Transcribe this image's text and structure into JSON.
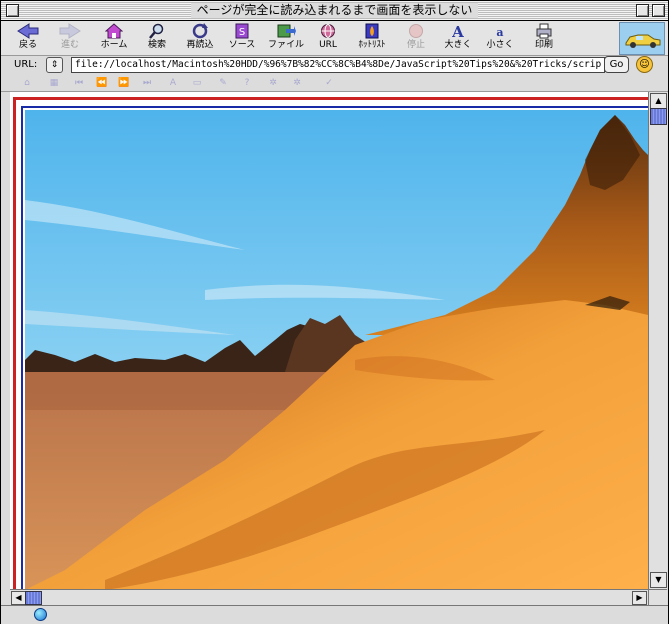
{
  "window": {
    "title": "ページが完全に読み込まれるまで画面を表示しない"
  },
  "toolbar": {
    "buttons": [
      {
        "label": "戻る",
        "icon": "back-arrow-icon",
        "enabled": true
      },
      {
        "label": "進む",
        "icon": "forward-arrow-icon",
        "enabled": false
      },
      {
        "label": "ホーム",
        "icon": "home-icon",
        "enabled": true
      },
      {
        "label": "検索",
        "icon": "search-icon",
        "enabled": true
      },
      {
        "label": "再読込",
        "icon": "reload-icon",
        "enabled": true
      },
      {
        "label": "ソース",
        "icon": "source-icon",
        "enabled": true
      },
      {
        "label": "ファイル",
        "icon": "file-icon",
        "enabled": true
      },
      {
        "label": "URL",
        "icon": "url-icon",
        "enabled": true
      },
      {
        "label": "ﾎｯﾄﾘｽﾄ",
        "icon": "hotlist-icon",
        "enabled": true
      },
      {
        "label": "停止",
        "icon": "stop-icon",
        "enabled": false
      },
      {
        "label": "大きく",
        "icon": "larger-text-icon",
        "enabled": true
      },
      {
        "label": "小さく",
        "icon": "smaller-text-icon",
        "enabled": true
      },
      {
        "label": "印刷",
        "icon": "print-icon",
        "enabled": true
      }
    ]
  },
  "urlbar": {
    "label": "URL:",
    "value": "file://localhost/Macintosh%20HDD/%96%7B%82%CC%8C%B4%8De/JavaScript%20Tips%20&%20Tricks/scrip",
    "go_label": "Go"
  },
  "colors": {
    "frame_red": "#cc2222",
    "frame_blue": "#1a2ba8",
    "sky": "#6fc6ef",
    "sand": "#e08a20"
  }
}
